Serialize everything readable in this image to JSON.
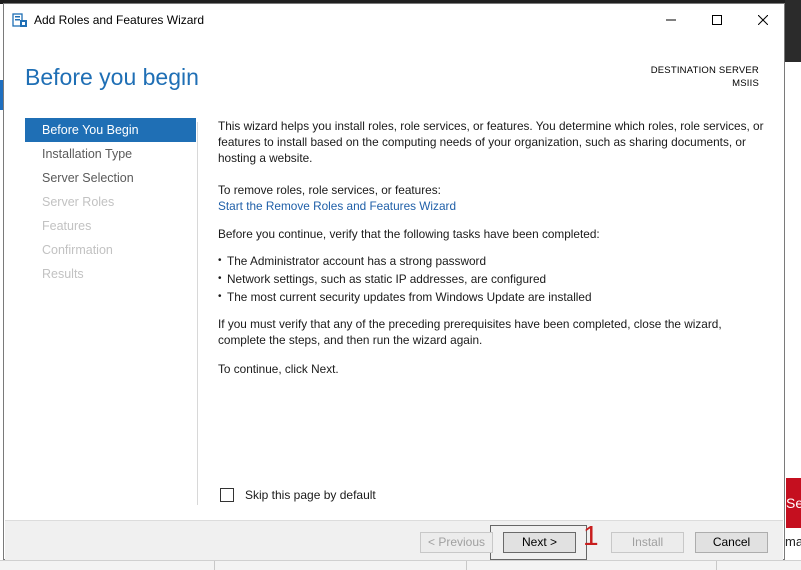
{
  "window": {
    "title": "Add Roles and Features Wizard",
    "icon": "server-manager-icon"
  },
  "header": {
    "page_title": "Before you begin",
    "destination_label": "DESTINATION SERVER",
    "destination_server": "MSIIS"
  },
  "nav": {
    "items": [
      {
        "label": "Before You Begin",
        "state": "active"
      },
      {
        "label": "Installation Type",
        "state": "enabled"
      },
      {
        "label": "Server Selection",
        "state": "enabled"
      },
      {
        "label": "Server Roles",
        "state": "disabled"
      },
      {
        "label": "Features",
        "state": "disabled"
      },
      {
        "label": "Confirmation",
        "state": "disabled"
      },
      {
        "label": "Results",
        "state": "disabled"
      }
    ]
  },
  "main": {
    "intro": "This wizard helps you install roles, role services, or features. You determine which roles, role services, or features to install based on the computing needs of your organization, such as sharing documents, or hosting a website.",
    "remove_text": "To remove roles, role services, or features:",
    "remove_link": "Start the Remove Roles and Features Wizard",
    "verify_text": "Before you continue, verify that the following tasks have been completed:",
    "bullets": [
      "The Administrator account has a strong password",
      "Network settings, such as static IP addresses, are configured",
      "The most current security updates from Windows Update are installed"
    ],
    "prereq_text": "If you must verify that any of the preceding prerequisites have been completed, close the wizard, complete the steps, and then run the wizard again.",
    "continue_text": "To continue, click Next."
  },
  "skip": {
    "label": "Skip this page by default",
    "checked": false
  },
  "footer": {
    "previous": "< Previous",
    "next": "Next >",
    "install": "Install",
    "cancel": "Cancel"
  },
  "annotation": {
    "step_number": "1",
    "color": "#c81e1e"
  },
  "background": {
    "tile_text": "Se",
    "fragment_text": "ma"
  },
  "colors": {
    "accent": "#1f6fb5",
    "link": "#1f5fa8",
    "disabled_text": "#c2c2c2"
  }
}
